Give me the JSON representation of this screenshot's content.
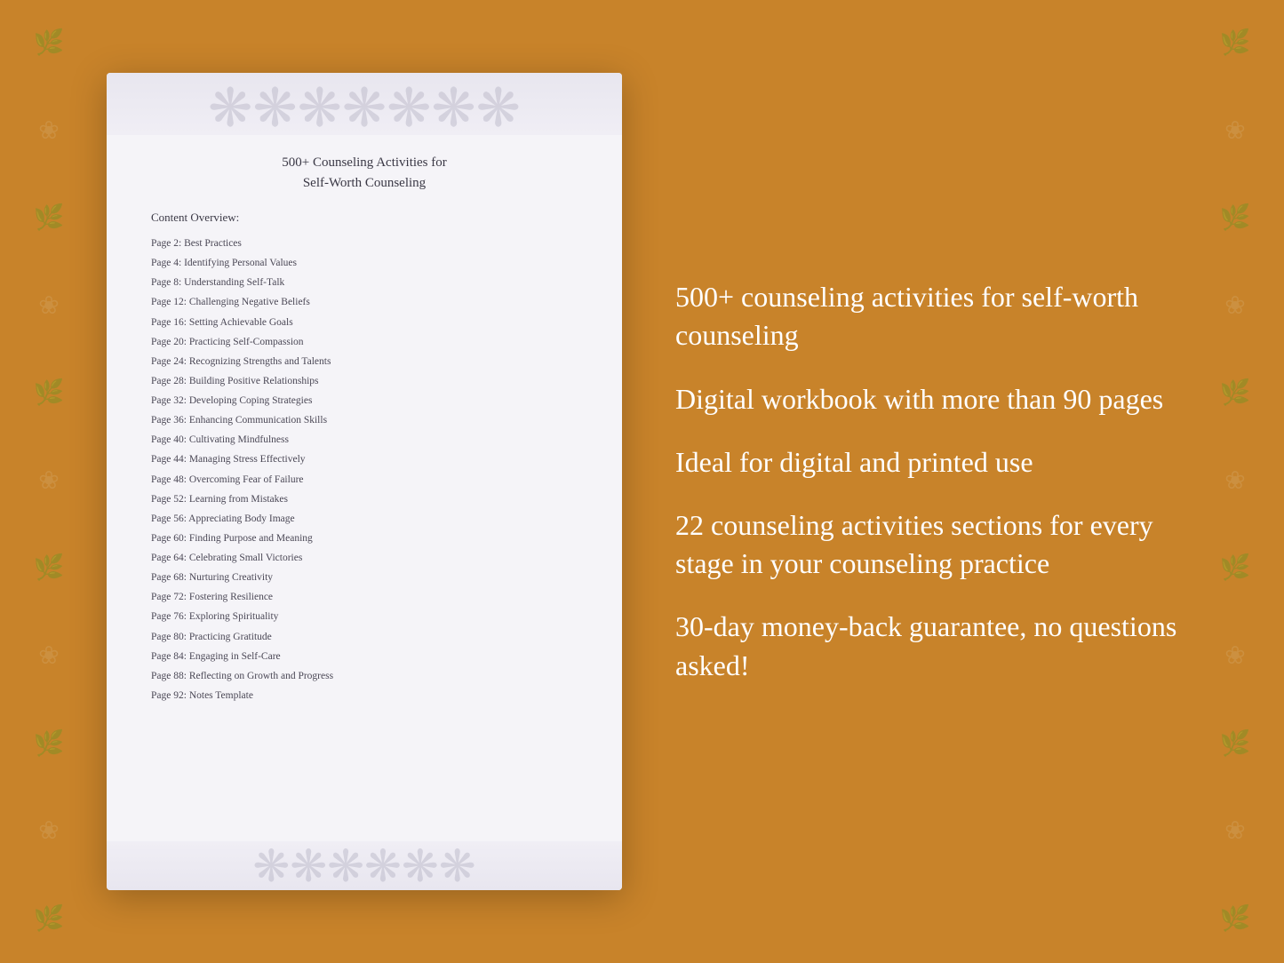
{
  "background_color": "#C8832A",
  "document": {
    "title_line1": "500+ Counseling Activities for",
    "title_line2": "Self-Worth Counseling",
    "content_overview_label": "Content Overview:",
    "toc": [
      {
        "page": "Page  2:",
        "title": "Best Practices"
      },
      {
        "page": "Page  4:",
        "title": "Identifying Personal Values"
      },
      {
        "page": "Page  8:",
        "title": "Understanding Self-Talk"
      },
      {
        "page": "Page 12:",
        "title": "Challenging Negative Beliefs"
      },
      {
        "page": "Page 16:",
        "title": "Setting Achievable Goals"
      },
      {
        "page": "Page 20:",
        "title": "Practicing Self-Compassion"
      },
      {
        "page": "Page 24:",
        "title": "Recognizing Strengths and Talents"
      },
      {
        "page": "Page 28:",
        "title": "Building Positive Relationships"
      },
      {
        "page": "Page 32:",
        "title": "Developing Coping Strategies"
      },
      {
        "page": "Page 36:",
        "title": "Enhancing Communication Skills"
      },
      {
        "page": "Page 40:",
        "title": "Cultivating Mindfulness"
      },
      {
        "page": "Page 44:",
        "title": "Managing Stress Effectively"
      },
      {
        "page": "Page 48:",
        "title": "Overcoming Fear of Failure"
      },
      {
        "page": "Page 52:",
        "title": "Learning from Mistakes"
      },
      {
        "page": "Page 56:",
        "title": "Appreciating Body Image"
      },
      {
        "page": "Page 60:",
        "title": "Finding Purpose and Meaning"
      },
      {
        "page": "Page 64:",
        "title": "Celebrating Small Victories"
      },
      {
        "page": "Page 68:",
        "title": "Nurturing Creativity"
      },
      {
        "page": "Page 72:",
        "title": "Fostering Resilience"
      },
      {
        "page": "Page 76:",
        "title": "Exploring Spirituality"
      },
      {
        "page": "Page 80:",
        "title": "Practicing Gratitude"
      },
      {
        "page": "Page 84:",
        "title": "Engaging in Self-Care"
      },
      {
        "page": "Page 88:",
        "title": "Reflecting on Growth and Progress"
      },
      {
        "page": "Page 92:",
        "title": "Notes Template"
      }
    ]
  },
  "features": [
    "500+ counseling activities for self-worth counseling",
    "Digital workbook with more than 90 pages",
    "Ideal for digital and printed use",
    "22 counseling activities sections for every stage in your counseling practice",
    "30-day money-back guarantee, no questions asked!"
  ],
  "floral_sprites": [
    "❀",
    "✿",
    "❁",
    "✾",
    "❀",
    "✿",
    "❁",
    "✾",
    "❀",
    "✿",
    "❁",
    "✾",
    "❀"
  ]
}
